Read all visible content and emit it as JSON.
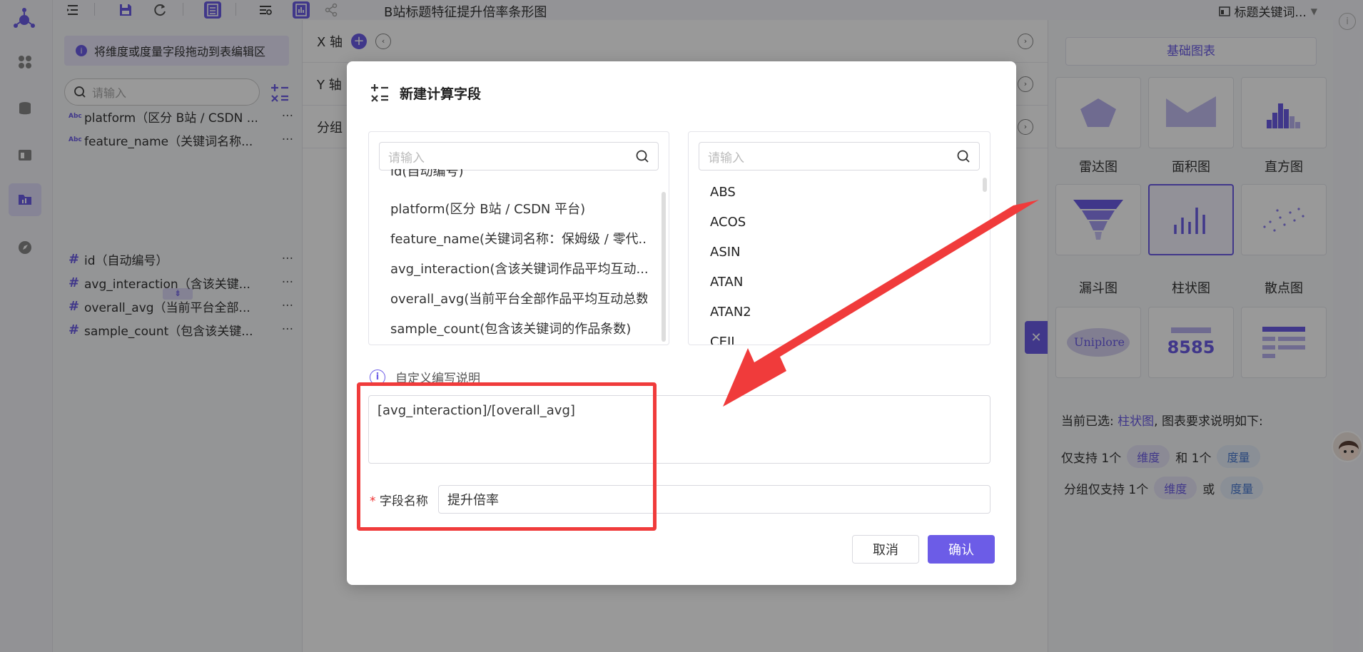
{
  "toolbar": {
    "title": "B站标题特征提升倍率条形图",
    "right_title": "标题关键词..."
  },
  "fields": {
    "hint": "将维度或度量字段拖动到表编辑区",
    "search_placeholder": "请输入",
    "dimensions": [
      {
        "type": "Abc",
        "name": "platform（区分 B站 / CSDN ..."
      },
      {
        "type": "Abc",
        "name": "feature_name（关键词名称..."
      }
    ],
    "measures": [
      {
        "name": "id（自动编号）"
      },
      {
        "name": "avg_interaction（含该关键..."
      },
      {
        "name": "overall_avg（当前平台全部..."
      },
      {
        "name": "sample_count（包含该关键..."
      }
    ]
  },
  "axes": {
    "x_label": "X 轴",
    "y_label": "Y 轴",
    "group_label": "分组"
  },
  "chart_panel": {
    "tab": "基础图表",
    "charts": [
      "雷达图",
      "面积图",
      "直方图",
      "漏斗图",
      "柱状图",
      "散点图"
    ],
    "kpi_value": "8585",
    "current_prefix": "当前已选:",
    "current_chart": "柱状图",
    "current_suffix": ", 图表要求说明如下:",
    "req1_pre": "仅支持 1个",
    "req1_mid": "和 1个",
    "req2_pre": "分组仅支持 1个",
    "req2_mid": "或",
    "dimension": "维度",
    "measure": "度量"
  },
  "modal": {
    "title": "新建计算字段",
    "left_search_placeholder": "请输入",
    "right_search_placeholder": "请输入",
    "field_list": [
      "id(自动编号)",
      "platform(区分 B站 / CSDN 平台)",
      "feature_name(关键词名称：保姆级 / 零代...",
      "avg_interaction(含该关键词作品平均互动...",
      "overall_avg(当前平台全部作品平均互动总数)",
      "sample_count(包含该关键词的作品条数)"
    ],
    "functions": [
      "ABS",
      "ACOS",
      "ASIN",
      "ATAN",
      "ATAN2",
      "CEIL"
    ],
    "help": "自定义编写说明",
    "expression": "[avg_interaction]/[overall_avg]",
    "name_label": "字段名称",
    "name_value": "提升倍率",
    "cancel": "取消",
    "confirm": "确认"
  }
}
